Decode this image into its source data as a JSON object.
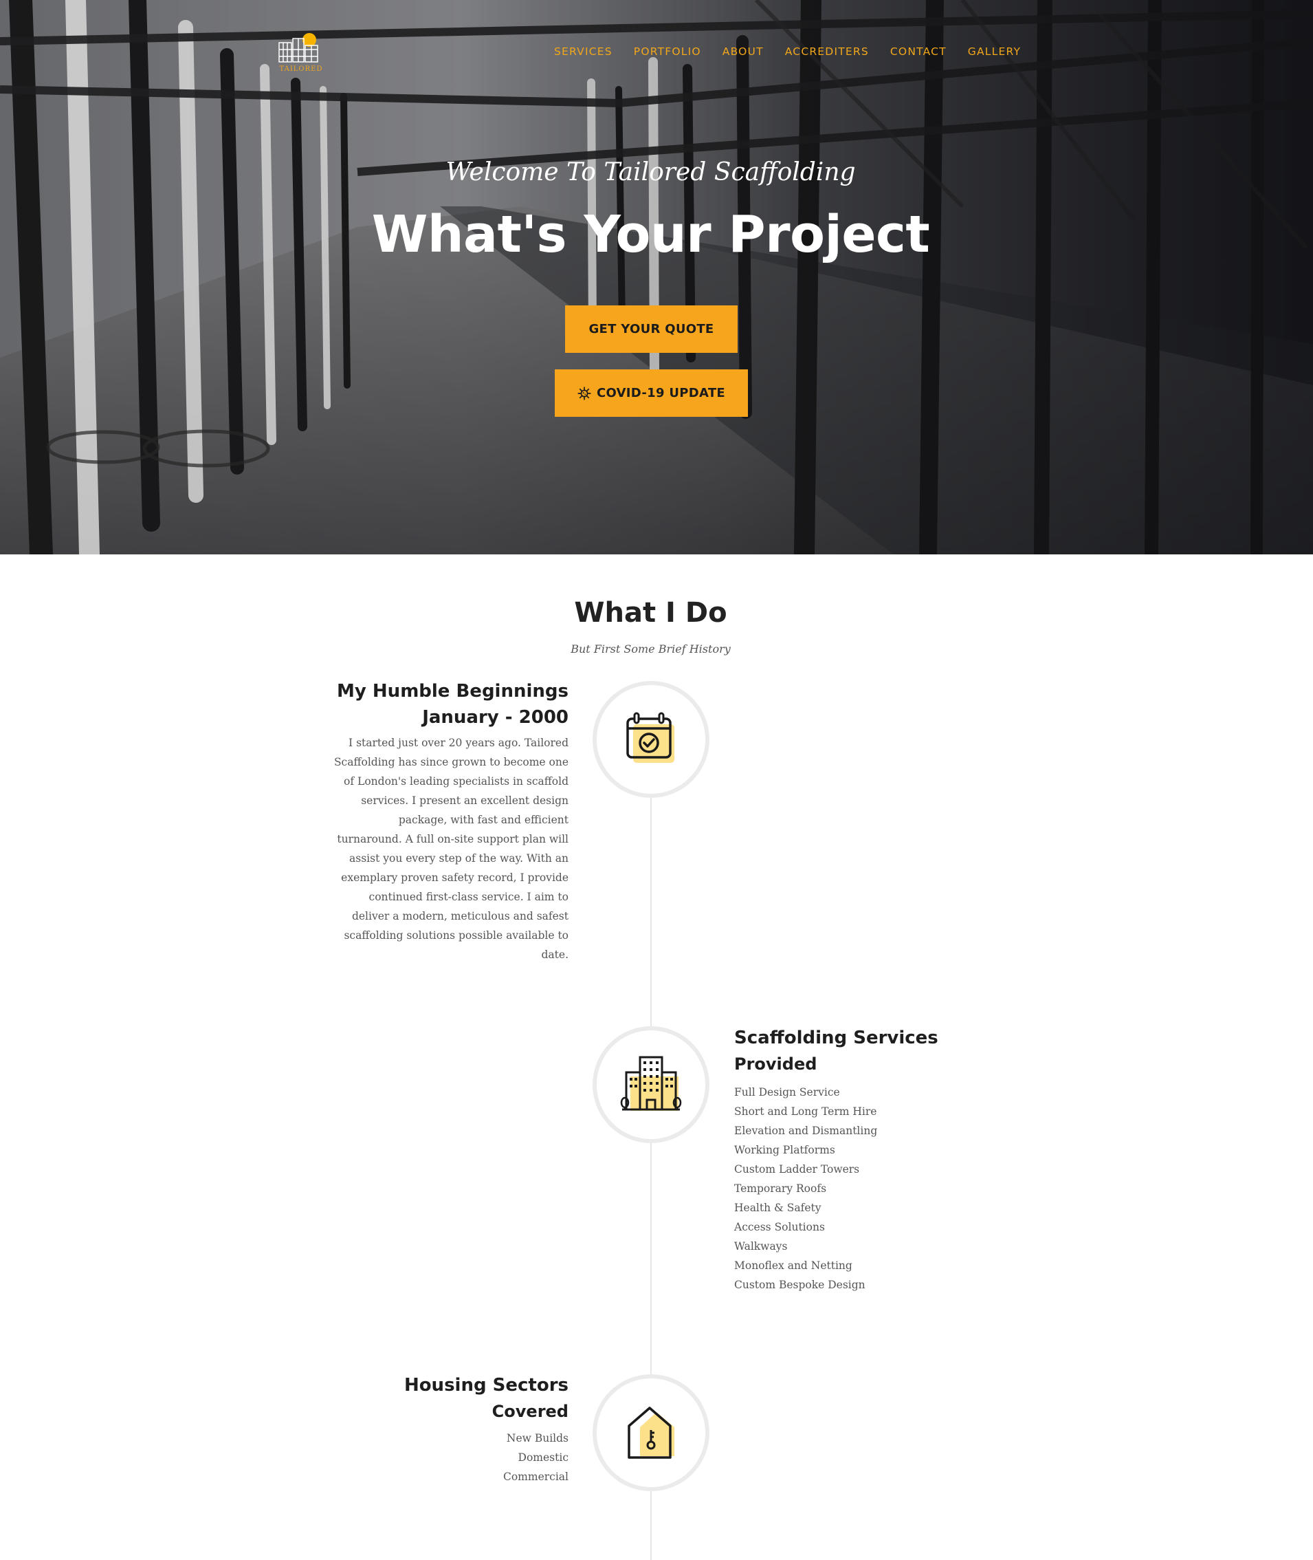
{
  "nav": {
    "items": [
      "SERVICES",
      "PORTFOLIO",
      "ABOUT",
      "ACCREDITERS",
      "CONTACT",
      "GALLERY"
    ],
    "color": "#f2a71b"
  },
  "logo": {
    "text": "TAILORED"
  },
  "hero": {
    "subtitle": "Welcome To Tailored Scaffolding",
    "title": "What's Your Project",
    "quote_button": "GET YOUR QUOTE",
    "covid_button": "COVID-19 UPDATE",
    "accent": "#f6a51d"
  },
  "section": {
    "title": "What I Do",
    "subtitle": "But First Some Brief History"
  },
  "timeline": {
    "beginnings": {
      "title_line1": "My Humble Beginnings",
      "title_line2": "January - 2000",
      "icon": "calendar-check-icon",
      "text": "I started just over 20 years ago. Tailored Scaffolding has since grown to become one of London's leading specialists in scaffold services. I present an excellent design package, with fast and efficient turnaround. A full on-site support plan will assist you every step of the way. With an exemplary proven safety record, I provide continued first-class service. I aim to deliver a modern, meticulous and safest scaffolding solutions possible available to date."
    },
    "services": {
      "title_line1": "Scaffolding Services",
      "title_line2": "Provided",
      "icon": "building-icon",
      "items": [
        "Full Design Service",
        "Short and Long Term Hire",
        "Elevation and Dismantling",
        "Working Platforms",
        "Custom Ladder Towers",
        "Temporary Roofs",
        "Health & Safety",
        "Access Solutions",
        "Walkways",
        "Monoflex and Netting",
        "Custom Bespoke Design"
      ]
    },
    "housing": {
      "title_line1": "Housing Sectors",
      "title_line2": "Covered",
      "icon": "house-key-icon",
      "items": [
        "New Builds",
        "Domestic",
        "Commercial"
      ]
    }
  }
}
